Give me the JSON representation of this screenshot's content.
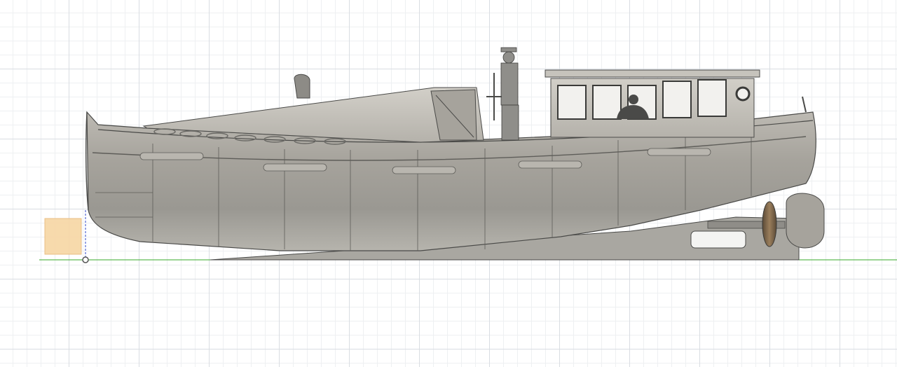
{
  "app": {
    "view": "side",
    "model": "launch-boat-3d-model"
  },
  "colors": {
    "grid_major": "#d9dde2",
    "grid_minor": "#eef0f2",
    "hull": "#a8a6a0",
    "hull_dark": "#8d8b86",
    "deck": "#c9c6bf",
    "outline": "#4a4a48",
    "x_axis": "#37a829",
    "y_axis": "#3048c8",
    "view_cube": "#f7d6a4",
    "propeller": "#7a6348"
  },
  "icons": {
    "origin": "origin-point-icon",
    "view_cube": "view-cube-face-icon"
  }
}
